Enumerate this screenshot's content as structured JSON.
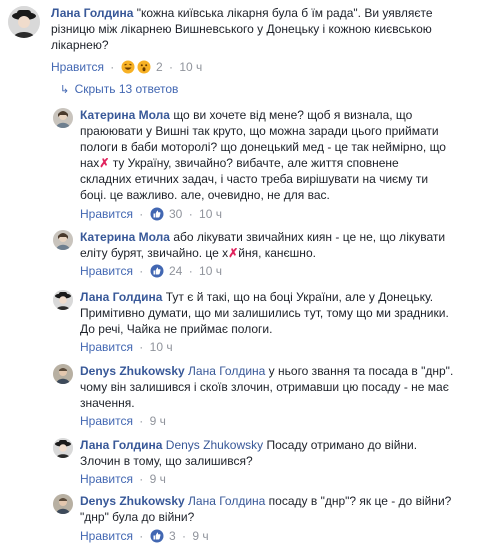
{
  "actions": {
    "like_label": "Нравится",
    "dot": "·"
  },
  "main_comment": {
    "author": "Лана Голдина",
    "text_1": " \"кожна київська лікарня була б їм рада\". Ви уявляєте",
    "text_2": "різницю між лікарнею Вишневського у Донецьку і кожною києвською",
    "text_3": "лікарнею?",
    "reaction_count": "2",
    "time": "10 ч"
  },
  "replies_toggle": {
    "arrow": "↳",
    "label": "Скрыть 13 ответов"
  },
  "replies": [
    {
      "author": "Катерина Мола",
      "lines": [
        " що ви хочете від мене? щоб я визнала, що",
        "праюювати у Вишні так круто, що можна заради цього приймати",
        "пологи в баби моторолі? що донецький мед - це так неймірно, що",
        "нах",
        " ту Україну, звичайно? вибачте, але життя сповнене",
        "складних етичних задач, і часто треба вирішувати на чиєму ти",
        "боці. це важливо. але, очевидно, не для вас."
      ],
      "reaction_count": "30",
      "time": "10 ч"
    },
    {
      "author": "Катерина Мола",
      "lines": [
        " або лікувати звичайних киян - це не, що лікувати",
        "еліту бурят, звичайно. це х",
        "йня, канєшно."
      ],
      "reaction_count": "24",
      "time": "10 ч"
    },
    {
      "author": "Лана Голдина",
      "lines": [
        " Тут є й такі, що на боці України, але у Донецьку.",
        "Примітивно думати, що ми залишились тут, тому що ми зрадники.",
        "До речі, Чайка не приймає пологи."
      ],
      "time": "10 ч"
    },
    {
      "author": "Denys Zhukowsky",
      "mention": "Лана Голдина",
      "lines": [
        " у нього звання та посада в \"днр\".",
        "чому він залишився і скоїв злочин, отримавши цю посаду - не має",
        "значення."
      ],
      "time": "9 ч"
    },
    {
      "author": "Лана Голдина",
      "mention": "Denys Zhukowsky",
      "lines": [
        " Посаду отримано до війни.",
        "Злочин в тому, що залишився?"
      ],
      "time": "9 ч"
    },
    {
      "author": "Denys Zhukowsky",
      "mention": "Лана Голдина",
      "lines": [
        " посаду в \"днр\"? як це - до війни?",
        "\"днр\" була до війни?"
      ],
      "reaction_count": "3",
      "time": "9 ч"
    }
  ],
  "colors": {
    "link": "#385898",
    "meta": "#90949c",
    "action": "#4267b2",
    "like_blue": "#4267b2",
    "haha_yellow": "#f7b125",
    "heart_red": "#e0245e"
  },
  "icons": {
    "like": "like-reaction-icon",
    "haha": "haha-reaction-icon",
    "wow": "wow-reaction-icon",
    "censor": "heart-censor-icon"
  }
}
